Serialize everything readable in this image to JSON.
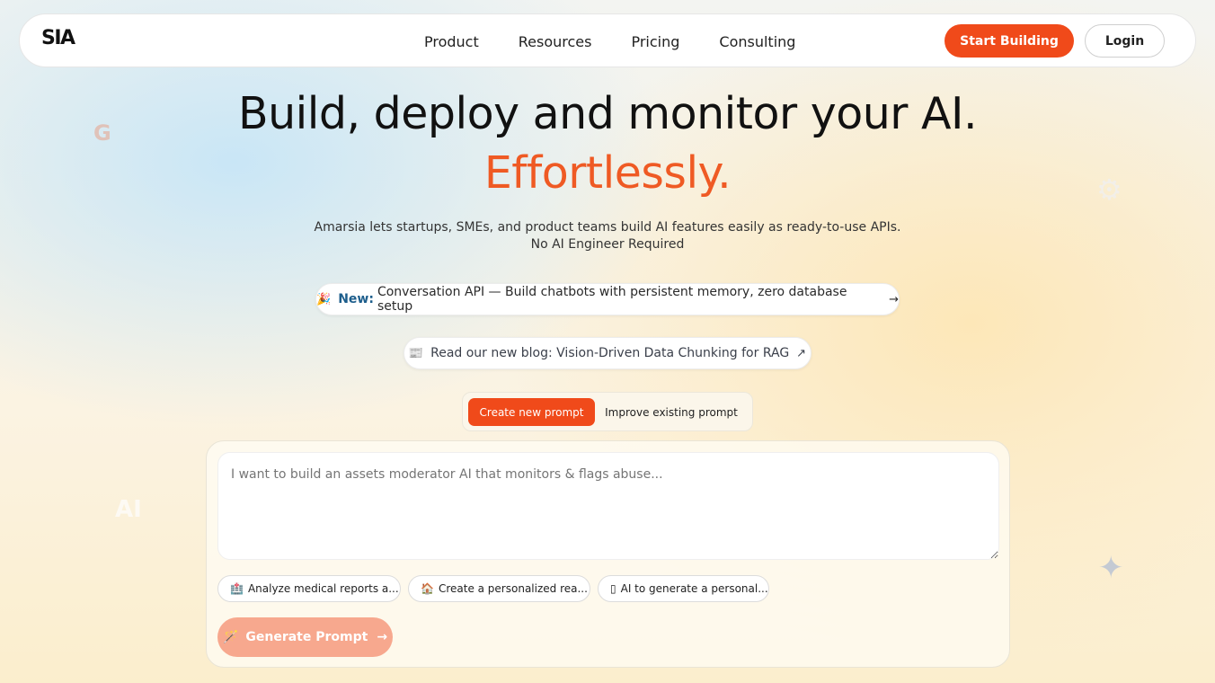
{
  "nav": {
    "logo": "SIA",
    "links": [
      "Product",
      "Resources",
      "Pricing",
      "Consulting"
    ],
    "start_label": "Start Building",
    "login_label": "Login"
  },
  "hero": {
    "title": "Build, deploy and monitor your AI.",
    "title_accent": "Effortlessly.",
    "subtitle_line1": "Amarsia lets startups, SMEs, and product teams build AI features easily as ready-to-use APIs.",
    "subtitle_line2": "No AI Engineer Required"
  },
  "announcements": {
    "new_icon": "🎉",
    "new_tag": "New:",
    "new_text": "Conversation API — Build chatbots with persistent memory, zero database setup",
    "new_arrow": "→",
    "blog_icon": "📰",
    "blog_text": "Read our new blog: Vision-Driven Data Chunking for RAG",
    "blog_arrow": "↗"
  },
  "tabs": {
    "active": "Create new prompt",
    "inactive": "Improve existing prompt"
  },
  "prompt": {
    "placeholder": "I want to build an assets moderator AI that monitors & flags abuse...",
    "chips": [
      {
        "icon": "🏥",
        "label": "Analyze medical reports a..."
      },
      {
        "icon": "🏠",
        "label": "Create a personalized rea..."
      },
      {
        "icon": "▯",
        "label": "AI to generate a personal..."
      }
    ],
    "generate_label": "Generate Prompt",
    "generate_icon": "🪄",
    "generate_arrow": "→"
  },
  "decor": {
    "google_glyph": "G",
    "ai_glyph": "AI",
    "star_glyph": "✦",
    "openai_glyph": "⚙"
  },
  "colors": {
    "accent": "#f04a1a",
    "accent_text": "#ef5a24",
    "new_tag": "#1d5e8c"
  }
}
